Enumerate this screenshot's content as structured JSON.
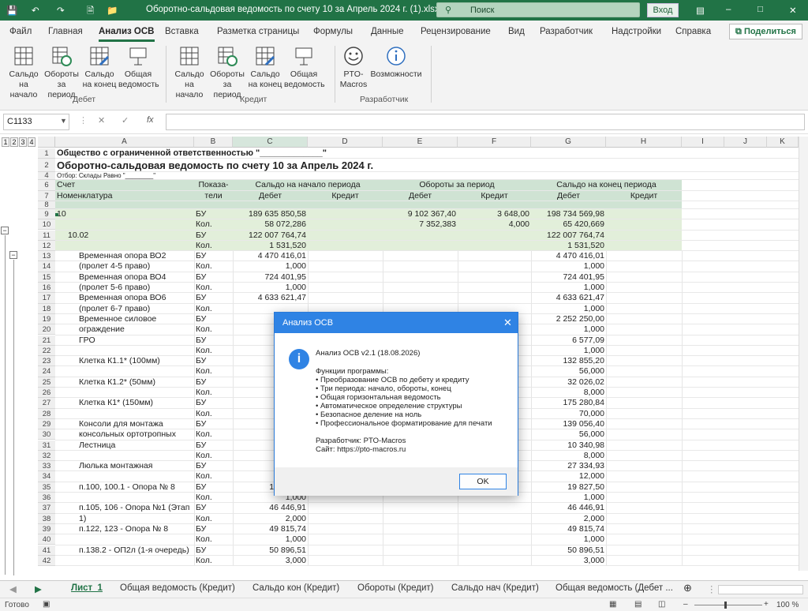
{
  "window": {
    "title": "Оборотно-сальдовая ведомость по счету 10 за Апрель 2024 г. (1).xlsx  -  Ex...",
    "search_placeholder": "Поиск",
    "signin": "Вход"
  },
  "tabs": [
    "Файл",
    "Главная",
    "Анализ ОСВ",
    "Вставка",
    "Разметка страницы",
    "Формулы",
    "Данные",
    "Рецензирование",
    "Вид",
    "Разработчик",
    "Надстройки",
    "Справка"
  ],
  "share_label": "Поделиться",
  "ribbon": {
    "groups": [
      {
        "label": "Дебет",
        "buttons": [
          {
            "l1": "Сальдо",
            "l2": "на начало",
            "icon": "grid-icon"
          },
          {
            "l1": "Обороты",
            "l2": "за период",
            "icon": "refresh-grid-icon"
          },
          {
            "l1": "Сальдо",
            "l2": "на конец",
            "icon": "grid-edit-icon"
          },
          {
            "l1": "Общая",
            "l2": "ведомость",
            "icon": "board-icon"
          }
        ]
      },
      {
        "label": "Кредит",
        "buttons": [
          {
            "l1": "Сальдо",
            "l2": "на начало",
            "icon": "grid-icon"
          },
          {
            "l1": "Обороты",
            "l2": "за период",
            "icon": "refresh-grid-icon"
          },
          {
            "l1": "Сальдо",
            "l2": "на конец",
            "icon": "grid-edit-icon"
          },
          {
            "l1": "Общая",
            "l2": "ведомость",
            "icon": "board-icon"
          }
        ]
      },
      {
        "label": "Разработчик",
        "buttons": [
          {
            "l1": "PTO-",
            "l2": "Macros",
            "icon": "smiley-icon"
          },
          {
            "l1": "Возможности",
            "l2": "",
            "icon": "info-icon"
          }
        ]
      }
    ]
  },
  "formula_bar": {
    "name_box": "C1133",
    "formula": ""
  },
  "outline_levels": [
    "1",
    "2",
    "3",
    "4"
  ],
  "columns": [
    "A",
    "B",
    "C",
    "D",
    "E",
    "F",
    "G",
    "H",
    "I",
    "J",
    "K"
  ],
  "rows": [
    {
      "n": "1",
      "a": "Общество с ограниченной ответственностью \"_____________\"",
      "bold": true
    },
    {
      "n": "2",
      "a": "Оборотно-сальдовая ведомость по счету 10 за Апрель 2024 г.",
      "big": true
    },
    {
      "n": "4",
      "a": "Отбор: Склады Равно \"________\"",
      "small": true
    },
    {
      "n": "6",
      "hdr": true,
      "a": "Счет",
      "b": "Показа-",
      "c": "Сальдо на начало периода",
      "e": "Обороты за период",
      "g": "Сальдо на конец периода"
    },
    {
      "n": "7",
      "hdr": true,
      "a": "Номенклатура",
      "b": "тели",
      "c": "Дебет",
      "d": "Кредит",
      "e": "Дебет",
      "f": "Кредит",
      "g": "Дебет",
      "h": "Кредит"
    },
    {
      "n": "8",
      "hdr": true
    },
    {
      "n": "9",
      "green": true,
      "a": "10",
      "b": "БУ",
      "c": "189 635 850,58",
      "e": "9 102 367,40",
      "f": "3 648,00",
      "g": "198 734 569,98"
    },
    {
      "n": "10",
      "green": true,
      "b": "Кол.",
      "c": "58 072,286",
      "e": "7 352,383",
      "f": "4,000",
      "g": "65 420,669"
    },
    {
      "n": "11",
      "green": true,
      "indent": 1,
      "a": "10.02",
      "b": "БУ",
      "c": "122 007 764,74",
      "g": "122 007 764,74"
    },
    {
      "n": "12",
      "green": true,
      "b": "Кол.",
      "c": "1 531,520",
      "g": "1 531,520"
    },
    {
      "n": "13",
      "indent": 2,
      "a": "Временная опора ВО2",
      "b": "БУ",
      "c": "4 470 416,01",
      "g": "4 470 416,01"
    },
    {
      "n": "14",
      "indent": 2,
      "a": "(пролет 4-5 право)",
      "b": "Кол.",
      "c": "1,000",
      "g": "1,000"
    },
    {
      "n": "15",
      "indent": 2,
      "a": "Временная опора ВО4",
      "b": "БУ",
      "c": "724 401,95",
      "g": "724 401,95"
    },
    {
      "n": "16",
      "indent": 2,
      "a": "(пролет 5-6 право)",
      "b": "Кол.",
      "c": "1,000",
      "g": "1,000"
    },
    {
      "n": "17",
      "indent": 2,
      "a": "Временная опора ВО6",
      "b": "БУ",
      "c": "4 633 621,47",
      "g": "4 633 621,47"
    },
    {
      "n": "18",
      "indent": 2,
      "a": "(пролет 6-7 право)",
      "b": "Кол.",
      "c": "",
      "g": "1,000"
    },
    {
      "n": "19",
      "indent": 2,
      "a": "Временное силовое",
      "b": "БУ",
      "c": "2 25",
      "g": "2 252 250,00"
    },
    {
      "n": "20",
      "indent": 2,
      "a": "ограждение",
      "b": "Кол.",
      "g": "1,000"
    },
    {
      "n": "21",
      "indent": 2,
      "a": "ГРО",
      "b": "БУ",
      "g": "6 577,09"
    },
    {
      "n": "22",
      "b": "Кол.",
      "g": "1,000"
    },
    {
      "n": "23",
      "indent": 2,
      "a": "Клетка К1.1* (100мм)",
      "b": "БУ",
      "c": "13",
      "g": "132 855,20"
    },
    {
      "n": "24",
      "b": "Кол.",
      "g": "56,000"
    },
    {
      "n": "25",
      "indent": 2,
      "a": "Клетка К1.2* (50мм)",
      "b": "БУ",
      "c": "3",
      "g": "32 026,02"
    },
    {
      "n": "26",
      "b": "Кол.",
      "g": "8,000"
    },
    {
      "n": "27",
      "indent": 2,
      "a": "Клетка К1* (150мм)",
      "b": "БУ",
      "c": "17",
      "g": "175 280,84"
    },
    {
      "n": "28",
      "b": "Кол.",
      "g": "70,000"
    },
    {
      "n": "29",
      "indent": 2,
      "a": "Консоли для монтажа",
      "b": "БУ",
      "c": "13",
      "g": "139 056,40"
    },
    {
      "n": "30",
      "indent": 2,
      "a": "консольных ортотропных",
      "b": "Кол.",
      "g": "56,000"
    },
    {
      "n": "31",
      "indent": 2,
      "a": "Лестница",
      "b": "БУ",
      "c": "1",
      "g": "10 340,98"
    },
    {
      "n": "32",
      "b": "Кол.",
      "g": "8,000"
    },
    {
      "n": "33",
      "indent": 2,
      "a": "Люлька монтажная",
      "b": "БУ",
      "c": "2",
      "g": "27 334,93"
    },
    {
      "n": "34",
      "b": "Кол.",
      "g": "12,000"
    },
    {
      "n": "35",
      "indent": 2,
      "a": "п.100, 100.1 - Опора № 8",
      "b": "БУ",
      "c": "19 827,50",
      "g": "19 827,50"
    },
    {
      "n": "36",
      "b": "Кол.",
      "c": "1,000",
      "g": "1,000"
    },
    {
      "n": "37",
      "indent": 2,
      "a": "п.105, 106 - Опора №1 (Этап",
      "b": "БУ",
      "c": "46 446,91",
      "g": "46 446,91"
    },
    {
      "n": "38",
      "indent": 2,
      "a": "1)",
      "b": "Кол.",
      "c": "2,000",
      "g": "2,000"
    },
    {
      "n": "39",
      "indent": 2,
      "a": "п.122, 123 - Опора № 8",
      "b": "БУ",
      "c": "49 815,74",
      "g": "49 815,74"
    },
    {
      "n": "40",
      "b": "Кол.",
      "c": "1,000",
      "g": "1,000"
    },
    {
      "n": "41",
      "indent": 2,
      "a": "п.138.2 - ОП2л (1-я очередь)",
      "b": "БУ",
      "c": "50 896,51",
      "g": "50 896,51"
    },
    {
      "n": "42",
      "b": "Кол.",
      "c": "3,000",
      "g": "3,000"
    }
  ],
  "sheets": [
    "Лист_1",
    "Общая ведомость (Кредит)",
    "Сальдо кон (Кредит)",
    "Обороты (Кредит)",
    "Сальдо нач (Кредит)",
    "Общая ведомость (Дебет ..."
  ],
  "status": {
    "ready": "Готово",
    "zoom": "100 %"
  },
  "dialog": {
    "title": "Анализ ОСВ",
    "version": "Анализ ОСВ v2.1 (18.08.2026)",
    "features_title": "Функции программы:",
    "features": [
      "• Преобразование ОСВ по дебету и кредиту",
      "• Три периода: начало, обороты, конец",
      "• Общая горизонтальная ведомость",
      "• Автоматическое определение структуры",
      "• Безопасное деление на ноль",
      "• Профессиональное форматирование для печати"
    ],
    "developer": "Разработчик: PTO-Macros",
    "site": "Сайт: https://pto-macros.ru",
    "ok": "OK"
  }
}
